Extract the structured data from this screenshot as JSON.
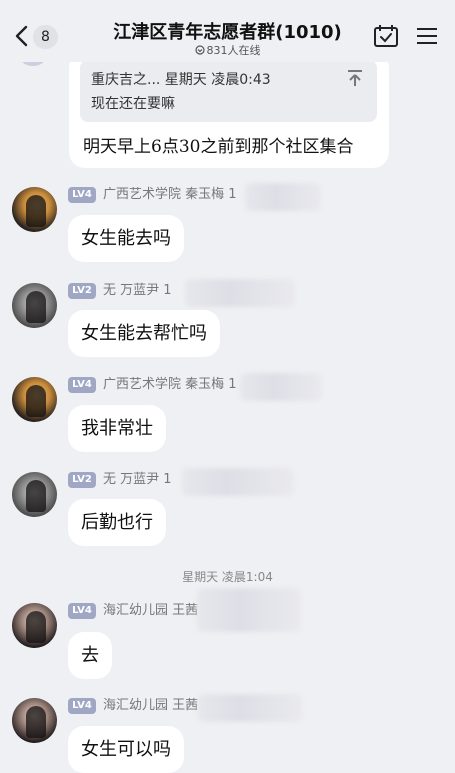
{
  "header": {
    "unread_count": "8",
    "title": "江津区青年志愿者群(1010)",
    "online": "831人在线"
  },
  "top_message": {
    "quote_meta": "重庆吉之... 星期天 凌晨0:43",
    "quote_text": "现在还在要嘛",
    "text": "明天早上6点30之前到那个社区集合"
  },
  "messages": [
    {
      "level": "LV4",
      "sender": "广西艺术学院 秦玉梅 1",
      "text": "女生能去吗"
    },
    {
      "level": "LV2",
      "sender": "无  万蓝尹  1",
      "text": "女生能去帮忙吗"
    },
    {
      "level": "LV4",
      "sender": "广西艺术学院 秦玉梅 1",
      "text": "我非常壮"
    },
    {
      "level": "LV2",
      "sender": "无  万蓝尹  1",
      "text": "后勤也行"
    },
    {
      "level": "LV4",
      "sender": "海汇幼儿园 王茜",
      "text": "去"
    },
    {
      "level": "LV4",
      "sender": "海汇幼儿园 王茜",
      "text": "女生可以吗"
    }
  ],
  "time_divider": "星期天 凌晨1:04",
  "colors": {
    "background": "#eff0f4",
    "bubble": "#ffffff",
    "level_badge": "#9fa7c4",
    "quote_bg": "#ebecf0"
  },
  "icons": [
    "back-chevron-icon",
    "online-status-icon",
    "calendar-check-icon",
    "menu-icon",
    "quote-jump-icon"
  ]
}
